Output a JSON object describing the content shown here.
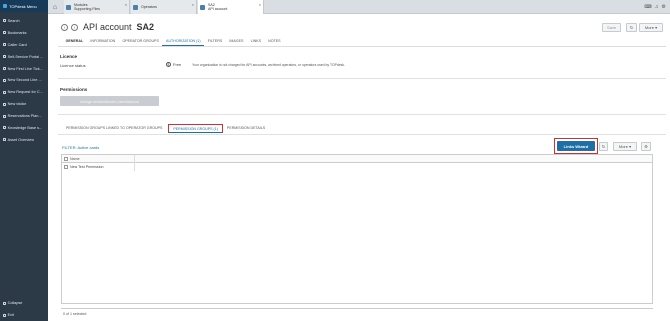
{
  "sidebar": {
    "app_title": "TOPdesk Menu",
    "items": [
      {
        "label": "Search",
        "icon": "search-icon"
      },
      {
        "label": "Bookmarks",
        "icon": "bookmark-icon"
      },
      {
        "label": "Caller Card",
        "icon": "caller-card-icon"
      },
      {
        "label": "Self-Service Portal ...",
        "icon": "portal-icon"
      },
      {
        "label": "New First Line Tick...",
        "icon": "ticket-icon"
      },
      {
        "label": "New Second Line ...",
        "icon": "ticket-icon"
      },
      {
        "label": "New Request for C...",
        "icon": "change-icon"
      },
      {
        "label": "New visitor",
        "icon": "visitor-icon"
      },
      {
        "label": "Reservations Plan...",
        "icon": "calendar-icon"
      },
      {
        "label": "Knowledge Base s...",
        "icon": "knowledge-icon"
      },
      {
        "label": "Asset Overview",
        "icon": "asset-icon"
      }
    ],
    "collapse_label": "Collapse",
    "exit_label": "Exit"
  },
  "tabs": [
    {
      "line1": "Modules",
      "line2": "Supporting Files"
    },
    {
      "line1": "Operators",
      "line2": ""
    },
    {
      "line1": "SA2",
      "line2": "API account"
    }
  ],
  "header": {
    "title_prefix": "API account",
    "title_name": "SA2",
    "save_label": "Save",
    "more_label": "More"
  },
  "subtabs": [
    "GENERAL",
    "INFORMATION",
    "OPERATOR GROUPS",
    "AUTHORIZATION (1)",
    "FILTERS",
    "IMAGES",
    "LINKS",
    "NOTES"
  ],
  "subtabs_active": "AUTHORIZATION (1)",
  "licence": {
    "section_title": "Licence",
    "status_label": "Licence status",
    "status_value": "Free",
    "note": "Your organization is not charged for API accounts, archived operators, or operators used by TOPdesk."
  },
  "permissions": {
    "section_title": "Permissions",
    "assign_label": "Assign administrator permissions"
  },
  "perm_tabs": [
    "PERMISSION GROUPS LINKED TO OPERATOR GROUPS",
    "PERMISSION GROUPS (1)",
    "PERMISSION DETAILS"
  ],
  "perm_tabs_active": "PERMISSION GROUPS (1)",
  "filter_label": "FILTER: Active cards",
  "links_wizard_label": "Links Wizard",
  "grid_more_label": "More",
  "grid": {
    "header_name": "Name",
    "rows": [
      "New Test Permission"
    ]
  },
  "footer": "0 of 1 selected",
  "colors": {
    "accent": "#1d6fa8",
    "highlight": "#d32f2f",
    "sidebar": "#2b3a46"
  }
}
